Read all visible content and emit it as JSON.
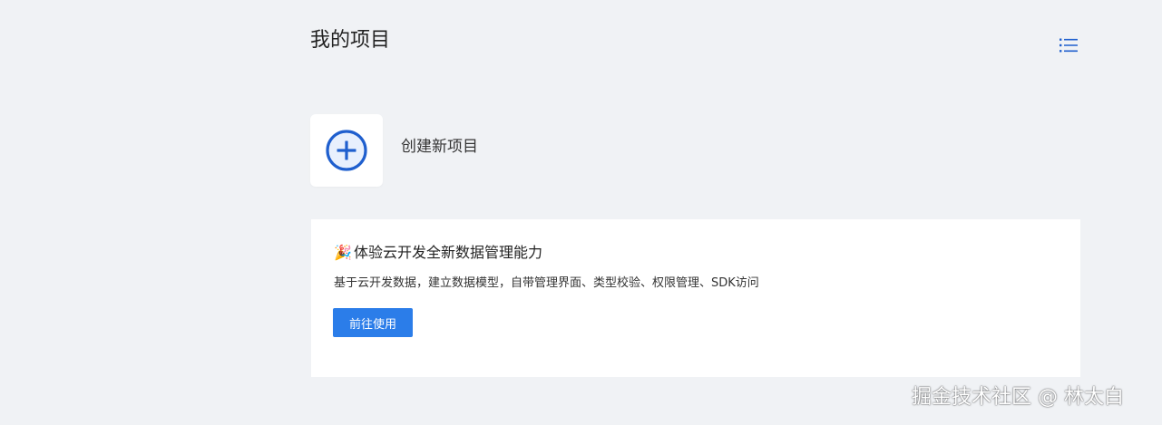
{
  "header": {
    "title": "我的项目",
    "view_toggle_icon": "list-view-icon"
  },
  "create_project": {
    "icon": "plus-circle-icon",
    "label": "创建新项目"
  },
  "promo": {
    "emoji": "🎉",
    "title": "体验云开发全新数据管理能力",
    "description": "基于云开发数据，建立数据模型，自带管理界面、类型校验、权限管理、SDK访问",
    "button_label": "前往使用"
  },
  "watermark": "掘金技术社区 @ 林太白",
  "colors": {
    "background": "#f0f2f5",
    "accent": "#1f5fce",
    "button": "#2b7de9",
    "card": "#ffffff"
  }
}
